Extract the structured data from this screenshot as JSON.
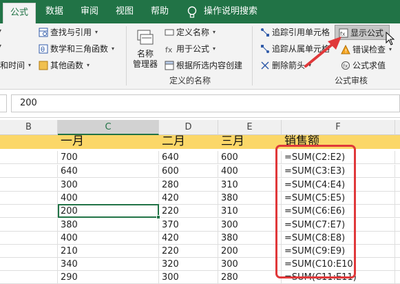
{
  "tabs": [
    {
      "label": "公式",
      "active": true
    },
    {
      "label": "数据",
      "active": false
    },
    {
      "label": "审阅",
      "active": false
    },
    {
      "label": "视图",
      "active": false
    },
    {
      "label": "帮助",
      "active": false
    },
    {
      "label": "操作说明搜索",
      "active": false
    }
  ],
  "ribbon": {
    "function_library": {
      "lookup": "查找与引用",
      "math": "数学和三角函数",
      "more": "其他函数",
      "datetime_partial": "和时间"
    },
    "defined_names": {
      "name_manager": [
        "名称",
        "管理器"
      ],
      "define_name": "定义名称",
      "use_in_formula": "用于公式",
      "create_from_selection": "根据所选内容创建",
      "group_label": "定义的名称"
    },
    "formula_auditing": {
      "trace_precedents": "追踪引用单元格",
      "trace_dependents": "追踪从属单元格",
      "remove_arrows": "删除箭头",
      "show_formulas": "显示公式",
      "error_checking": "错误检查",
      "evaluate_formula": "公式求值",
      "group_label": "公式审核"
    }
  },
  "formula_bar": {
    "value": "200"
  },
  "columns": [
    "B",
    "C",
    "D",
    "E",
    "F"
  ],
  "header_row": {
    "c": "一月",
    "d": "二月",
    "e": "三月",
    "f": "销售额"
  },
  "rows": [
    {
      "c": "700",
      "d": "640",
      "e": "600",
      "f": "=SUM(C2:E2)"
    },
    {
      "c": "640",
      "d": "600",
      "e": "400",
      "f": "=SUM(C3:E3)"
    },
    {
      "c": "300",
      "d": "280",
      "e": "310",
      "f": "=SUM(C4:E4)"
    },
    {
      "c": "400",
      "d": "420",
      "e": "380",
      "f": "=SUM(C5:E5)"
    },
    {
      "c": "200",
      "d": "220",
      "e": "310",
      "f": "=SUM(C6:E6)"
    },
    {
      "c": "380",
      "d": "370",
      "e": "300",
      "f": "=SUM(C7:E7)"
    },
    {
      "c": "400",
      "d": "420",
      "e": "380",
      "f": "=SUM(C8:E8)"
    },
    {
      "c": "210",
      "d": "220",
      "e": "200",
      "f": "=SUM(C9:E9)"
    },
    {
      "c": "340",
      "d": "320",
      "e": "300",
      "f": "=SUM(C10:E10)"
    },
    {
      "c": "290",
      "d": "300",
      "e": "280",
      "f": "=SUM(C11:E11)"
    }
  ],
  "colors": {
    "ribbon_green": "#217346",
    "header_fill": "#fbd768",
    "highlight_red": "#e0383a"
  }
}
